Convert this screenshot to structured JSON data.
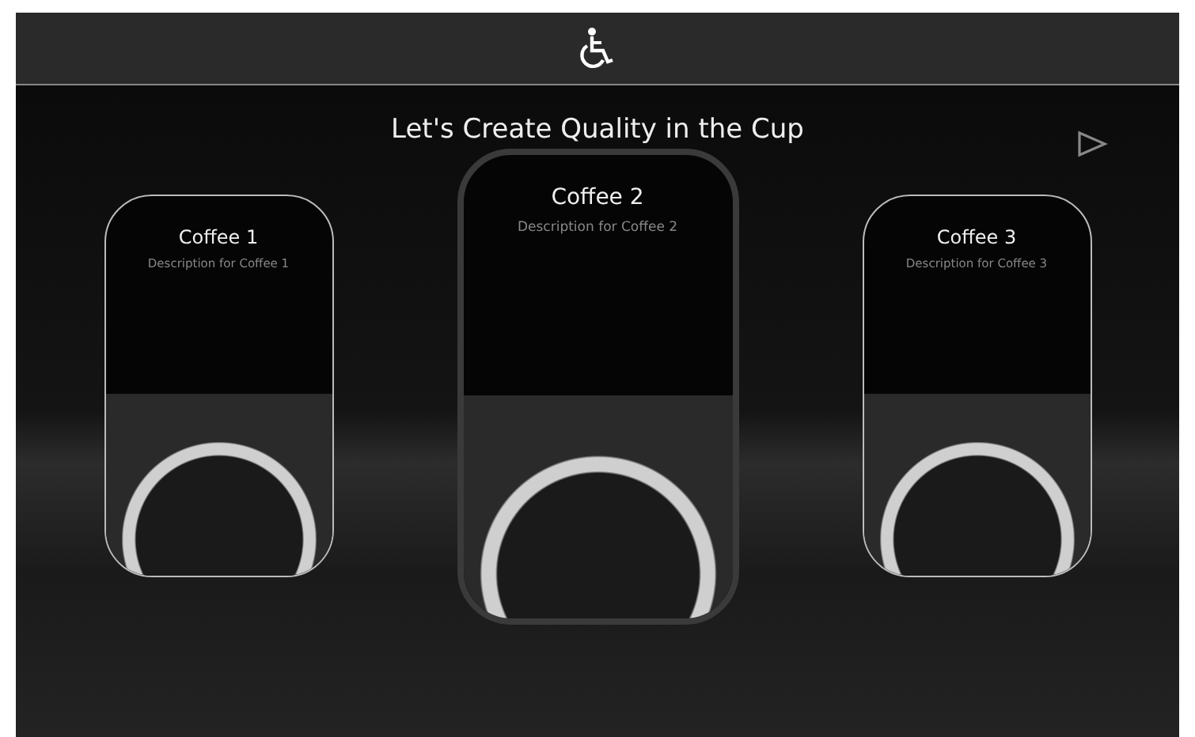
{
  "title": "Let's Create Quality in the Cup",
  "cards": [
    {
      "title": "Coffee 1",
      "description": "Description for Coffee 1",
      "selected": false
    },
    {
      "title": "Coffee 2",
      "description": "Description for Coffee 2",
      "selected": true
    },
    {
      "title": "Coffee 3",
      "description": "Description for Coffee 3",
      "selected": false
    }
  ]
}
